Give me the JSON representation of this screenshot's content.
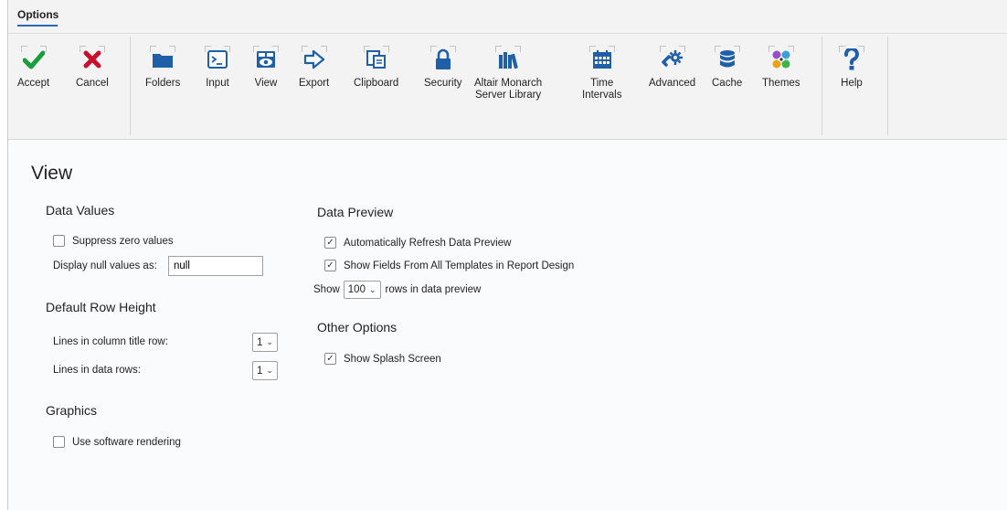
{
  "ribbon": {
    "tab_label": "Options",
    "buttons": [
      {
        "id": "accept",
        "label": "Accept",
        "icon": "check-icon"
      },
      {
        "id": "cancel",
        "label": "Cancel",
        "icon": "x-icon"
      },
      {
        "id": "folders",
        "label": "Folders",
        "icon": "folder-icon"
      },
      {
        "id": "input",
        "label": "Input",
        "icon": "terminal-icon"
      },
      {
        "id": "view",
        "label": "View",
        "icon": "view-eye-icon"
      },
      {
        "id": "export",
        "label": "Export",
        "icon": "arrow-right-icon"
      },
      {
        "id": "clipboard",
        "label": "Clipboard",
        "icon": "clipboard-icon"
      },
      {
        "id": "security",
        "label": "Security",
        "icon": "lock-icon"
      },
      {
        "id": "server_library",
        "label": "Altair Monarch\nServer Library",
        "icon": "library-icon"
      },
      {
        "id": "time_intervals",
        "label": "Time\nIntervals",
        "icon": "calendar-icon"
      },
      {
        "id": "advanced",
        "label": "Advanced",
        "icon": "wrench-gear-icon"
      },
      {
        "id": "cache",
        "label": "Cache",
        "icon": "database-icon"
      },
      {
        "id": "themes",
        "label": "Themes",
        "icon": "palette-icon"
      },
      {
        "id": "help",
        "label": "Help",
        "icon": "question-icon"
      }
    ]
  },
  "page": {
    "title": "View",
    "data_values": {
      "heading": "Data Values",
      "suppress_zero_label": "Suppress zero values",
      "suppress_zero_checked": false,
      "null_label": "Display null values as:",
      "null_value": "null"
    },
    "row_height": {
      "heading": "Default Row Height",
      "title_row_label": "Lines in column title row:",
      "title_row_value": "1",
      "data_rows_label": "Lines in data rows:",
      "data_rows_value": "1"
    },
    "graphics": {
      "heading": "Graphics",
      "software_rendering_label": "Use software rendering",
      "software_rendering_checked": false
    },
    "data_preview": {
      "heading": "Data Preview",
      "auto_refresh_label": "Automatically Refresh Data Preview",
      "auto_refresh_checked": true,
      "show_fields_label": "Show Fields From All Templates in Report Design",
      "show_fields_checked": true,
      "show_prefix": "Show",
      "rows_value": "100",
      "rows_suffix": "rows in data preview"
    },
    "other_options": {
      "heading": "Other Options",
      "splash_label": "Show Splash Screen",
      "splash_checked": true
    }
  },
  "colors": {
    "accent": "#2a69b4",
    "accept_green": "#1a9e3a",
    "cancel_red": "#c8102e",
    "icon_blue": "#1f5fa8"
  }
}
